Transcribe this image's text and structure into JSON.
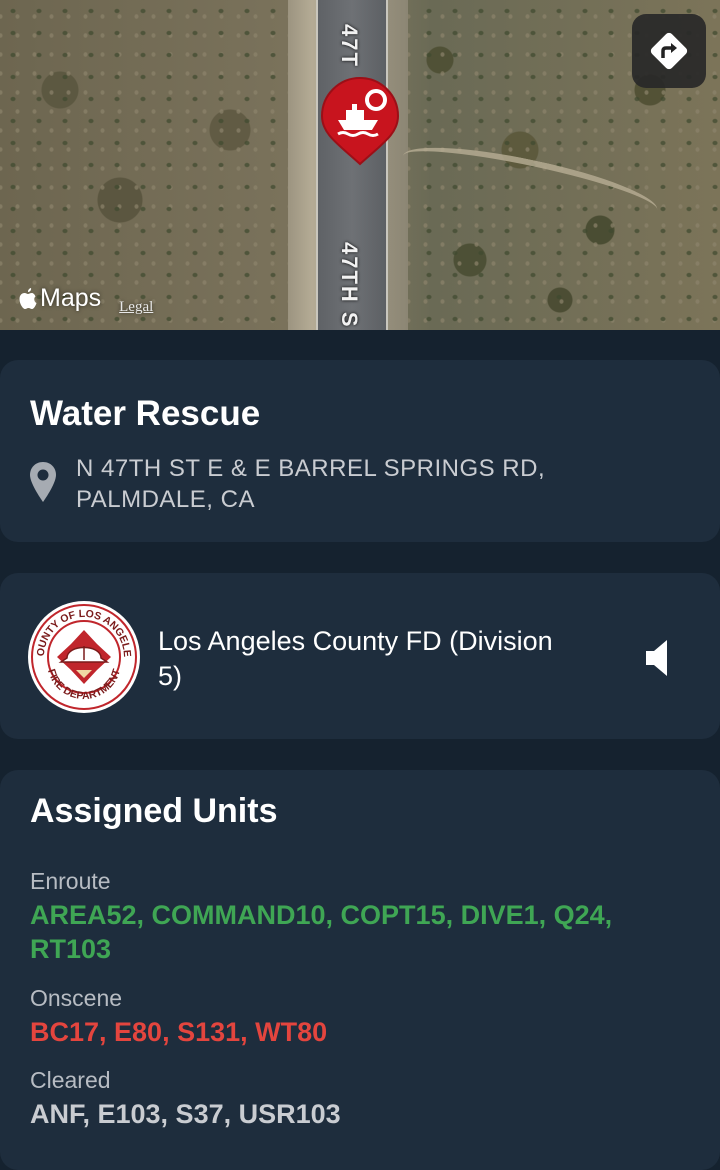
{
  "map": {
    "road_label_top": "47T",
    "road_label_bottom": "47TH S",
    "attribution": "Maps",
    "legal_link": "Legal",
    "pin_icon": "boat-lifering-icon",
    "pin_color": "#c8141e",
    "directions_icon": "directions-icon"
  },
  "incident": {
    "title": "Water Rescue",
    "address": "N 47TH ST E & E BARREL SPRINGS RD, PALMDALE, CA",
    "location_icon": "map-pin-icon"
  },
  "agency": {
    "name": "Los Angeles County FD (Division 5)",
    "logo_text_top": "COUNTY OF LOS ANGELES",
    "logo_text_bottom": "FIRE DEPARTMENT",
    "audio_icon": "speaker-icon"
  },
  "units": {
    "title": "Assigned Units",
    "enroute_label": "Enroute",
    "enroute": "AREA52, COMMAND10, COPT15, DIVE1, Q24, RT103",
    "onscene_label": "Onscene",
    "onscene": "BC17, E80, S131, WT80",
    "cleared_label": "Cleared",
    "cleared": "ANF, E103, S37, USR103"
  },
  "colors": {
    "background": "#15222f",
    "card": "#1e2d3d",
    "enroute": "#3fa654",
    "onscene": "#e4453e",
    "cleared": "#c9ccd1"
  }
}
